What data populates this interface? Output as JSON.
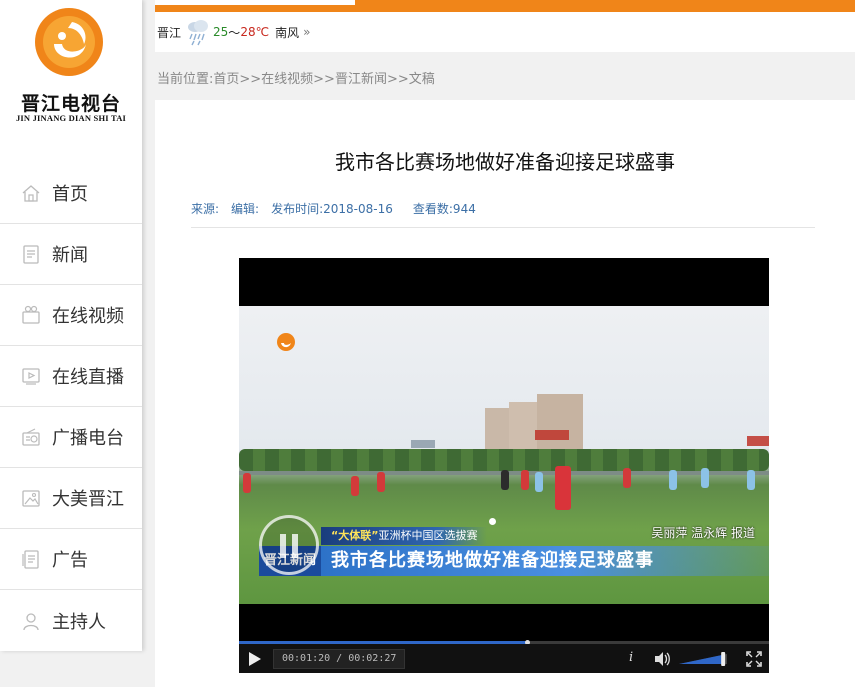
{
  "brand": {
    "name_cn": "晋江电视台",
    "name_en": "JIN JINANG  DIAN SHI TAI",
    "logo_color": "#f08519"
  },
  "sidebar": {
    "items": [
      {
        "label": "首页",
        "icon": "home-icon"
      },
      {
        "label": "新闻",
        "icon": "news-icon"
      },
      {
        "label": "在线视频",
        "icon": "video-icon"
      },
      {
        "label": "在线直播",
        "icon": "live-icon"
      },
      {
        "label": "广播电台",
        "icon": "radio-icon"
      },
      {
        "label": "大美晋江",
        "icon": "picture-icon"
      },
      {
        "label": "广告",
        "icon": "ad-icon"
      },
      {
        "label": "主持人",
        "icon": "user-icon"
      }
    ]
  },
  "weather": {
    "city": "晋江",
    "low": "25",
    "sep": "～",
    "high": "28",
    "unit": "℃",
    "wind": "南风",
    "more": "»"
  },
  "breadcrumb": "当前位置:首页>>在线视频>>晋江新闻>>文稿",
  "article": {
    "title": "我市各比赛场地做好准备迎接足球盛事",
    "source_label": "来源:",
    "editor_label": "编辑:",
    "published": "发布时间:2018-08-16",
    "views": "查看数:944"
  },
  "video": {
    "lower_third_tag": "“大体联”",
    "lower_third_top": "亚洲杯中国区选拔赛",
    "lower_third_brand": "晋江新闻",
    "lower_third_title": "我市各比赛场地做好准备迎接足球盛事",
    "reporter": "吴丽萍  温永辉  报道",
    "time_display": "00:01:20 / 00:02:27",
    "progress_fraction": 0.544,
    "volume_fraction": 0.92,
    "info_label": "i"
  }
}
